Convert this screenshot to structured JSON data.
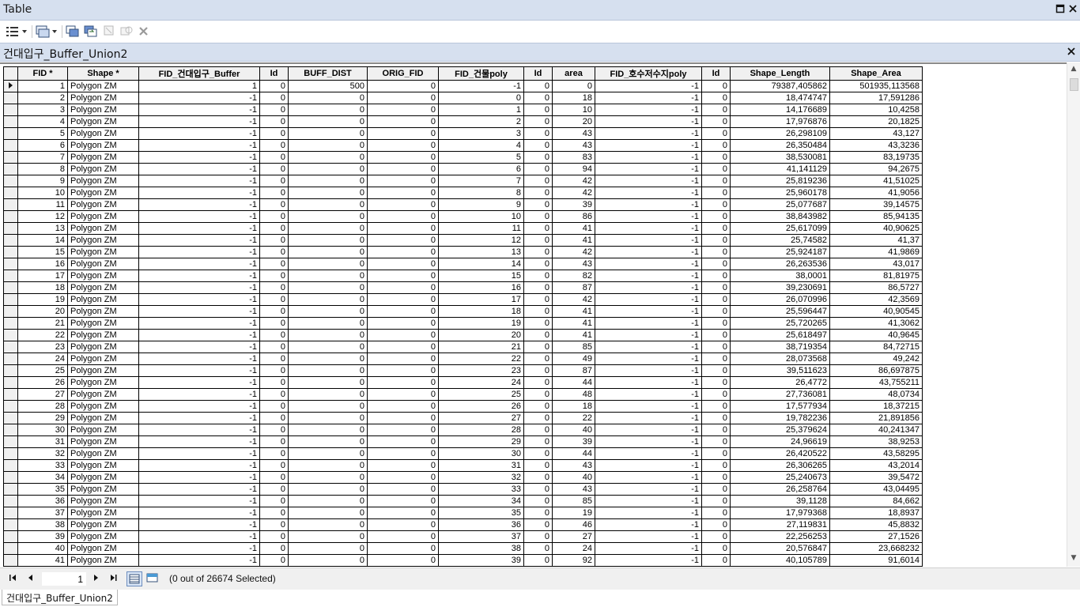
{
  "window": {
    "title": "Table"
  },
  "table_name": "건대입구_Buffer_Union2",
  "columns": [
    "FID *",
    "Shape *",
    "FID_건대입구_Buffer",
    "Id",
    "BUFF_DIST",
    "ORIG_FID",
    "FID_건물poly",
    "Id",
    "area",
    "FID_호수저수지poly",
    "Id",
    "Shape_Length",
    "Shape_Area"
  ],
  "rows": [
    [
      "1",
      "Polygon ZM",
      "1",
      "0",
      "500",
      "0",
      "-1",
      "0",
      "0",
      "-1",
      "0",
      "79387,405862",
      "501935,113568"
    ],
    [
      "2",
      "Polygon ZM",
      "-1",
      "0",
      "0",
      "0",
      "0",
      "0",
      "18",
      "-1",
      "0",
      "18,474747",
      "17,591286"
    ],
    [
      "3",
      "Polygon ZM",
      "-1",
      "0",
      "0",
      "0",
      "1",
      "0",
      "10",
      "-1",
      "0",
      "14,176689",
      "10,4258"
    ],
    [
      "4",
      "Polygon ZM",
      "-1",
      "0",
      "0",
      "0",
      "2",
      "0",
      "20",
      "-1",
      "0",
      "17,976876",
      "20,1825"
    ],
    [
      "5",
      "Polygon ZM",
      "-1",
      "0",
      "0",
      "0",
      "3",
      "0",
      "43",
      "-1",
      "0",
      "26,298109",
      "43,127"
    ],
    [
      "6",
      "Polygon ZM",
      "-1",
      "0",
      "0",
      "0",
      "4",
      "0",
      "43",
      "-1",
      "0",
      "26,350484",
      "43,3236"
    ],
    [
      "7",
      "Polygon ZM",
      "-1",
      "0",
      "0",
      "0",
      "5",
      "0",
      "83",
      "-1",
      "0",
      "38,530081",
      "83,19735"
    ],
    [
      "8",
      "Polygon ZM",
      "-1",
      "0",
      "0",
      "0",
      "6",
      "0",
      "94",
      "-1",
      "0",
      "41,141129",
      "94,2675"
    ],
    [
      "9",
      "Polygon ZM",
      "-1",
      "0",
      "0",
      "0",
      "7",
      "0",
      "42",
      "-1",
      "0",
      "25,819236",
      "41,51025"
    ],
    [
      "10",
      "Polygon ZM",
      "-1",
      "0",
      "0",
      "0",
      "8",
      "0",
      "42",
      "-1",
      "0",
      "25,960178",
      "41,9056"
    ],
    [
      "11",
      "Polygon ZM",
      "-1",
      "0",
      "0",
      "0",
      "9",
      "0",
      "39",
      "-1",
      "0",
      "25,077687",
      "39,14575"
    ],
    [
      "12",
      "Polygon ZM",
      "-1",
      "0",
      "0",
      "0",
      "10",
      "0",
      "86",
      "-1",
      "0",
      "38,843982",
      "85,94135"
    ],
    [
      "13",
      "Polygon ZM",
      "-1",
      "0",
      "0",
      "0",
      "11",
      "0",
      "41",
      "-1",
      "0",
      "25,617099",
      "40,90625"
    ],
    [
      "14",
      "Polygon ZM",
      "-1",
      "0",
      "0",
      "0",
      "12",
      "0",
      "41",
      "-1",
      "0",
      "25,74582",
      "41,37"
    ],
    [
      "15",
      "Polygon ZM",
      "-1",
      "0",
      "0",
      "0",
      "13",
      "0",
      "42",
      "-1",
      "0",
      "25,924187",
      "41,9869"
    ],
    [
      "16",
      "Polygon ZM",
      "-1",
      "0",
      "0",
      "0",
      "14",
      "0",
      "43",
      "-1",
      "0",
      "26,263536",
      "43,017"
    ],
    [
      "17",
      "Polygon ZM",
      "-1",
      "0",
      "0",
      "0",
      "15",
      "0",
      "82",
      "-1",
      "0",
      "38,0001",
      "81,81975"
    ],
    [
      "18",
      "Polygon ZM",
      "-1",
      "0",
      "0",
      "0",
      "16",
      "0",
      "87",
      "-1",
      "0",
      "39,230691",
      "86,5727"
    ],
    [
      "19",
      "Polygon ZM",
      "-1",
      "0",
      "0",
      "0",
      "17",
      "0",
      "42",
      "-1",
      "0",
      "26,070996",
      "42,3569"
    ],
    [
      "20",
      "Polygon ZM",
      "-1",
      "0",
      "0",
      "0",
      "18",
      "0",
      "41",
      "-1",
      "0",
      "25,596447",
      "40,90545"
    ],
    [
      "21",
      "Polygon ZM",
      "-1",
      "0",
      "0",
      "0",
      "19",
      "0",
      "41",
      "-1",
      "0",
      "25,720265",
      "41,3062"
    ],
    [
      "22",
      "Polygon ZM",
      "-1",
      "0",
      "0",
      "0",
      "20",
      "0",
      "41",
      "-1",
      "0",
      "25,618497",
      "40,9645"
    ],
    [
      "23",
      "Polygon ZM",
      "-1",
      "0",
      "0",
      "0",
      "21",
      "0",
      "85",
      "-1",
      "0",
      "38,719354",
      "84,72715"
    ],
    [
      "24",
      "Polygon ZM",
      "-1",
      "0",
      "0",
      "0",
      "22",
      "0",
      "49",
      "-1",
      "0",
      "28,073568",
      "49,242"
    ],
    [
      "25",
      "Polygon ZM",
      "-1",
      "0",
      "0",
      "0",
      "23",
      "0",
      "87",
      "-1",
      "0",
      "39,511623",
      "86,697875"
    ],
    [
      "26",
      "Polygon ZM",
      "-1",
      "0",
      "0",
      "0",
      "24",
      "0",
      "44",
      "-1",
      "0",
      "26,4772",
      "43,755211"
    ],
    [
      "27",
      "Polygon ZM",
      "-1",
      "0",
      "0",
      "0",
      "25",
      "0",
      "48",
      "-1",
      "0",
      "27,736081",
      "48,0734"
    ],
    [
      "28",
      "Polygon ZM",
      "-1",
      "0",
      "0",
      "0",
      "26",
      "0",
      "18",
      "-1",
      "0",
      "17,577934",
      "18,37215"
    ],
    [
      "29",
      "Polygon ZM",
      "-1",
      "0",
      "0",
      "0",
      "27",
      "0",
      "22",
      "-1",
      "0",
      "19,782236",
      "21,891856"
    ],
    [
      "30",
      "Polygon ZM",
      "-1",
      "0",
      "0",
      "0",
      "28",
      "0",
      "40",
      "-1",
      "0",
      "25,379624",
      "40,241347"
    ],
    [
      "31",
      "Polygon ZM",
      "-1",
      "0",
      "0",
      "0",
      "29",
      "0",
      "39",
      "-1",
      "0",
      "24,96619",
      "38,9253"
    ],
    [
      "32",
      "Polygon ZM",
      "-1",
      "0",
      "0",
      "0",
      "30",
      "0",
      "44",
      "-1",
      "0",
      "26,420522",
      "43,58295"
    ],
    [
      "33",
      "Polygon ZM",
      "-1",
      "0",
      "0",
      "0",
      "31",
      "0",
      "43",
      "-1",
      "0",
      "26,306265",
      "43,2014"
    ],
    [
      "34",
      "Polygon ZM",
      "-1",
      "0",
      "0",
      "0",
      "32",
      "0",
      "40",
      "-1",
      "0",
      "25,240673",
      "39,5472"
    ],
    [
      "35",
      "Polygon ZM",
      "-1",
      "0",
      "0",
      "0",
      "33",
      "0",
      "43",
      "-1",
      "0",
      "26,258764",
      "43,04495"
    ],
    [
      "36",
      "Polygon ZM",
      "-1",
      "0",
      "0",
      "0",
      "34",
      "0",
      "85",
      "-1",
      "0",
      "39,1128",
      "84,662"
    ],
    [
      "37",
      "Polygon ZM",
      "-1",
      "0",
      "0",
      "0",
      "35",
      "0",
      "19",
      "-1",
      "0",
      "17,979368",
      "18,8937"
    ],
    [
      "38",
      "Polygon ZM",
      "-1",
      "0",
      "0",
      "0",
      "36",
      "0",
      "46",
      "-1",
      "0",
      "27,119831",
      "45,8832"
    ],
    [
      "39",
      "Polygon ZM",
      "-1",
      "0",
      "0",
      "0",
      "37",
      "0",
      "27",
      "-1",
      "0",
      "22,256253",
      "27,1526"
    ],
    [
      "40",
      "Polygon ZM",
      "-1",
      "0",
      "0",
      "0",
      "38",
      "0",
      "24",
      "-1",
      "0",
      "20,576847",
      "23,668232"
    ],
    [
      "41",
      "Polygon ZM",
      "-1",
      "0",
      "0",
      "0",
      "39",
      "0",
      "92",
      "-1",
      "0",
      "40,105789",
      "91,6014"
    ]
  ],
  "navigation": {
    "current_record": "1",
    "selection_status": "(0 out of 26674 Selected)"
  },
  "bottom_tab": {
    "label": "건대입구_Buffer_Union2"
  },
  "icons": {
    "first": "first-record-icon",
    "prev": "previous-record-icon",
    "next": "next-record-icon",
    "last": "last-record-icon"
  },
  "colors": {
    "titlebar": "#d6e0ef",
    "header_bg": "#f0f0f0",
    "grid_line": "#000000"
  }
}
